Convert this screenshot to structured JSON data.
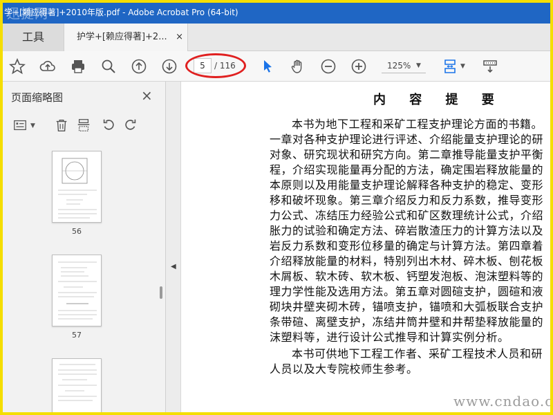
{
  "window": {
    "title": "学+[赖应得著]+2010年版.pdf - Adobe Acrobat Pro (64-bit)",
    "watermark_corner": "迅捷网"
  },
  "tabs": {
    "tools_label": "工具",
    "doc_label": "护学+[赖应得著]+2...",
    "close_glyph": "×"
  },
  "toolbar": {
    "current_page": "5",
    "page_total": "/ 116",
    "zoom": "125%",
    "icons": [
      "star-icon",
      "cloud-upload-icon",
      "print-icon",
      "search-icon",
      "page-up-icon",
      "page-down-icon",
      "select-cursor-icon",
      "hand-icon",
      "zoom-out-icon",
      "zoom-in-icon",
      "fit-page-icon",
      "keyboard-icon"
    ]
  },
  "sidebar": {
    "title": "页面缩略图",
    "close_glyph": "×",
    "thumbnails": [
      {
        "label": "56"
      },
      {
        "label": "57"
      },
      {
        "label": ""
      }
    ]
  },
  "document": {
    "title": "内 容 提 要",
    "lines": [
      "本书为地下工程和采矿工程支护理论方面的书籍。",
      "一章对各种支护理论进行评述、介绍能量支护理论的研",
      "对象、研究现状和研究方向。第二章推导能量支护平衡",
      "程，介绍实现能量再分配的方法，确定围岩释放能量的",
      "本原则以及用能量支护理论解释各种支护的稳定、变形",
      "移和破坏现象。第三章介绍反力和反力系数，推导变形",
      "力公式、冻结压力经验公式和矿区数理统计公式，介绍",
      "胀力的试验和确定方法、碎岩散渣压力的计算方法以及",
      "岩反力系数和变形位移量的确定与计算方法。第四章着",
      "介绍释放能量的材料，特别列出木材、碎木板、刨花板",
      "木屑板、软木砖、软木板、钙塑发泡板、泡沫塑料等的",
      "理力学性能及选用方法。第五章对圆碹支护，圆碹和液",
      "砌块井壁夹砌木砖，锚喷支护，锚喷和大弧板联合支护",
      "条带碹、离壁支护，冻结井筒井壁和井帮垫释放能量的",
      "沫塑料等，进行设计公式推导和计算实例分析。",
      "本书可供地下工程工作者、采矿工程技术人员和研",
      "人员以及大专院校师生参考。"
    ]
  },
  "watermark": "www.cndao.com",
  "colors": {
    "title_bar": "#1f66c4",
    "frame_border": "#f5de00",
    "highlight_ellipse": "#e02020",
    "accent_icon": "#1a73e8"
  }
}
